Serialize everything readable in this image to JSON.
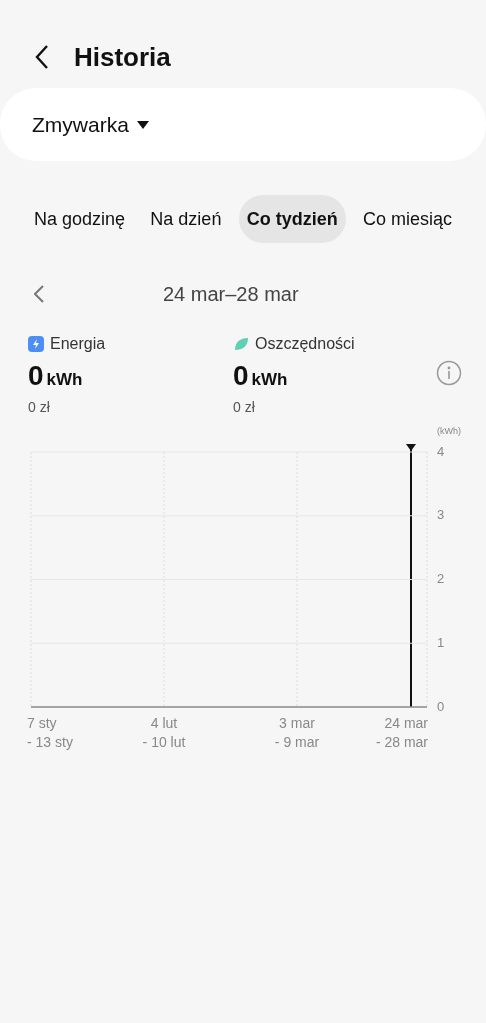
{
  "header": {
    "title": "Historia"
  },
  "device": {
    "label": "Zmywarka"
  },
  "tabs": [
    {
      "label": "Na godzinę",
      "selected": false
    },
    {
      "label": "Na dzień",
      "selected": false
    },
    {
      "label": "Co tydzień",
      "selected": true
    },
    {
      "label": "Co miesiąc",
      "selected": false
    }
  ],
  "period": {
    "label": "24 mar–28 mar"
  },
  "stats": [
    {
      "kind": "energy",
      "label": "Energia",
      "value": "0",
      "unit": "kWh",
      "cost": "0 zł"
    },
    {
      "kind": "savings",
      "label": "Oszczędności",
      "value": "0",
      "unit": "kWh",
      "cost": "0 zł"
    }
  ],
  "chart": {
    "unit": "(kWh)",
    "chart_data": {
      "type": "bar",
      "categories": [
        "7 sty\n- 13 sty",
        "4 lut\n- 10 lut",
        "3 mar\n- 9 mar",
        "24 mar\n- 28 mar"
      ],
      "values": [
        0,
        0,
        0,
        0
      ],
      "ylim": [
        0,
        4
      ],
      "grid": true,
      "yticks": [
        0,
        1,
        2,
        3,
        4
      ]
    }
  }
}
